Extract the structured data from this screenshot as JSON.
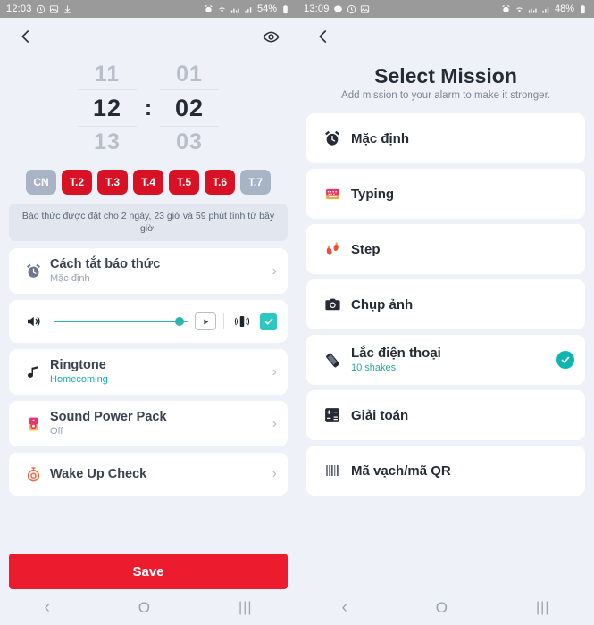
{
  "left": {
    "statusbar": {
      "time": "12:03",
      "left_icons": [
        "history-icon",
        "image-icon",
        "download-icon"
      ],
      "right_icons": [
        "alarm-icon",
        "wifi-icon",
        "dual-sim-icon",
        "signal-icon"
      ],
      "battery": "54%"
    },
    "topbar": {
      "back": "back-icon",
      "eye": "eye-icon"
    },
    "timepicker": {
      "hour_prev": "11",
      "hour": "12",
      "hour_next": "13",
      "separator": ":",
      "minute_prev": "01",
      "minute": "02",
      "minute_next": "03"
    },
    "days": [
      {
        "label": "CN",
        "active": false
      },
      {
        "label": "T.2",
        "active": true
      },
      {
        "label": "T.3",
        "active": true
      },
      {
        "label": "T.4",
        "active": true
      },
      {
        "label": "T.5",
        "active": true
      },
      {
        "label": "T.6",
        "active": true
      },
      {
        "label": "T.7",
        "active": false
      }
    ],
    "info": "Báo thức được đặt cho 2 ngày, 23 giờ và 59 phút tính từ bây giờ.",
    "cards": [
      {
        "icon": "alarm-clock-icon",
        "title": "Cách tắt báo thức",
        "sub": "Mặc định"
      },
      {
        "icon": "music-note-icon",
        "title": "Ringtone",
        "sub": "Homecoming"
      },
      {
        "icon": "speaker-icon",
        "title": "Sound Power Pack",
        "sub": "Off"
      },
      {
        "icon": "stopwatch-icon",
        "title": "Wake Up Check",
        "sub": ""
      }
    ],
    "volume_row": {
      "volume_icon": "volume-icon",
      "level_percent": 97,
      "preview_icon": "play-icon",
      "vibrate_icon": "vibrate-icon",
      "vibrate_checked": true
    },
    "save_label": "Save",
    "navbar": {
      "back": "‹",
      "home": "O",
      "recents": "|||"
    }
  },
  "right": {
    "statusbar": {
      "time": "13:09",
      "left_icons": [
        "message-icon",
        "history-icon",
        "image-icon"
      ],
      "right_icons": [
        "alarm-icon",
        "wifi-icon",
        "dual-sim-icon",
        "signal-icon"
      ],
      "battery": "48%"
    },
    "topbar": {
      "back": "back-icon"
    },
    "title": "Select Mission",
    "subtitle": "Add mission to your alarm to make it stronger.",
    "missions": [
      {
        "icon": "alarm-clock-icon",
        "title": "Mặc định",
        "sub": "",
        "selected": false
      },
      {
        "icon": "keyboard-icon",
        "title": "Typing",
        "sub": "",
        "selected": false
      },
      {
        "icon": "footsteps-icon",
        "title": "Step",
        "sub": "",
        "selected": false
      },
      {
        "icon": "camera-icon",
        "title": "Chụp ảnh",
        "sub": "",
        "selected": false
      },
      {
        "icon": "shake-phone-icon",
        "title": "Lắc điện thoại",
        "sub": "10 shakes",
        "selected": true
      },
      {
        "icon": "math-grid-icon",
        "title": "Giải toán",
        "sub": "",
        "selected": false
      },
      {
        "icon": "barcode-icon",
        "title": "Mã vạch/mã QR",
        "sub": "",
        "selected": false
      }
    ],
    "navbar": {
      "back": "‹",
      "home": "O",
      "recents": "|||"
    }
  },
  "colors": {
    "accent_red": "#ed1b2e",
    "day_active": "#d81224",
    "day_inactive": "#a8b4c6",
    "teal": "#2bb5ad",
    "page_bg": "#eef1f7"
  }
}
